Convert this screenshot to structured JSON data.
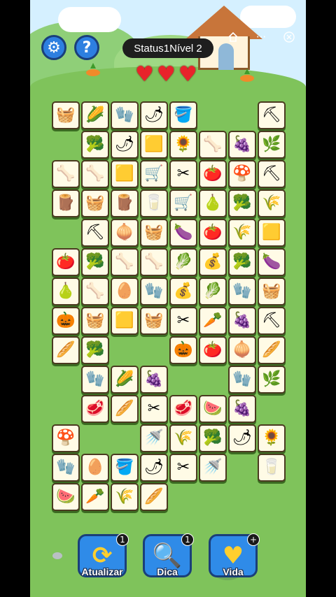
{
  "header": {
    "status_title": "Status1Nível 2",
    "settings_icon": "gear-icon",
    "help_icon": "question-icon",
    "home_icon": "home-icon",
    "more_icon": "more-icon",
    "close_icon": "close-icon",
    "lives": 3
  },
  "board": {
    "tiles": [
      {
        "row": 0,
        "col": 0,
        "icon": "basket",
        "glyph": "🧺"
      },
      {
        "row": 0,
        "col": 1,
        "icon": "corn",
        "glyph": "🌽"
      },
      {
        "row": 0,
        "col": 2,
        "icon": "glove",
        "glyph": "🧤"
      },
      {
        "row": 0,
        "col": 3,
        "icon": "chili-pepper",
        "glyph": "🌶"
      },
      {
        "row": 0,
        "col": 4,
        "icon": "bucket",
        "glyph": "🪣"
      },
      {
        "row": 0,
        "col": 7,
        "icon": "shovel",
        "glyph": "⛏"
      },
      {
        "row": 1,
        "col": 1,
        "icon": "broccoli",
        "glyph": "🥦"
      },
      {
        "row": 1,
        "col": 2,
        "icon": "chili-pepper",
        "glyph": "🌶"
      },
      {
        "row": 1,
        "col": 3,
        "icon": "hay-bale",
        "glyph": "🟨"
      },
      {
        "row": 1,
        "col": 4,
        "icon": "sunflower-seed",
        "glyph": "🌻"
      },
      {
        "row": 1,
        "col": 5,
        "icon": "bone",
        "glyph": "🦴"
      },
      {
        "row": 1,
        "col": 6,
        "icon": "grapes",
        "glyph": "🍇"
      },
      {
        "row": 1,
        "col": 7,
        "icon": "grass",
        "glyph": "🌿"
      },
      {
        "row": 2,
        "col": 0,
        "icon": "bone",
        "glyph": "🦴"
      },
      {
        "row": 2,
        "col": 1,
        "icon": "bone",
        "glyph": "🦴"
      },
      {
        "row": 2,
        "col": 2,
        "icon": "hay-bale",
        "glyph": "🟨"
      },
      {
        "row": 2,
        "col": 3,
        "icon": "wheelbarrow",
        "glyph": "🛒"
      },
      {
        "row": 2,
        "col": 4,
        "icon": "scissors",
        "glyph": "✂"
      },
      {
        "row": 2,
        "col": 5,
        "icon": "tomato",
        "glyph": "🍅"
      },
      {
        "row": 2,
        "col": 6,
        "icon": "mushroom",
        "glyph": "🍄"
      },
      {
        "row": 2,
        "col": 7,
        "icon": "shovel",
        "glyph": "⛏"
      },
      {
        "row": 3,
        "col": 0,
        "icon": "logs",
        "glyph": "🪵"
      },
      {
        "row": 3,
        "col": 1,
        "icon": "basket",
        "glyph": "🧺"
      },
      {
        "row": 3,
        "col": 2,
        "icon": "logs",
        "glyph": "🪵"
      },
      {
        "row": 3,
        "col": 3,
        "icon": "milk-carton",
        "glyph": "🥛"
      },
      {
        "row": 3,
        "col": 4,
        "icon": "wheelbarrow",
        "glyph": "🛒"
      },
      {
        "row": 3,
        "col": 5,
        "icon": "pear",
        "glyph": "🍐"
      },
      {
        "row": 3,
        "col": 6,
        "icon": "broccoli",
        "glyph": "🥦"
      },
      {
        "row": 3,
        "col": 7,
        "icon": "wheat",
        "glyph": "🌾"
      },
      {
        "row": 4,
        "col": 1,
        "icon": "shovel",
        "glyph": "⛏"
      },
      {
        "row": 4,
        "col": 2,
        "icon": "onion",
        "glyph": "🧅"
      },
      {
        "row": 4,
        "col": 3,
        "icon": "basket",
        "glyph": "🧺"
      },
      {
        "row": 4,
        "col": 4,
        "icon": "eggplant",
        "glyph": "🍆"
      },
      {
        "row": 4,
        "col": 5,
        "icon": "tomato",
        "glyph": "🍅"
      },
      {
        "row": 4,
        "col": 6,
        "icon": "wheat",
        "glyph": "🌾"
      },
      {
        "row": 4,
        "col": 7,
        "icon": "hay-bale",
        "glyph": "🟨"
      },
      {
        "row": 5,
        "col": 0,
        "icon": "tomato",
        "glyph": "🍅"
      },
      {
        "row": 5,
        "col": 1,
        "icon": "broccoli",
        "glyph": "🥦"
      },
      {
        "row": 5,
        "col": 2,
        "icon": "bone",
        "glyph": "🦴"
      },
      {
        "row": 5,
        "col": 3,
        "icon": "bone",
        "glyph": "🦴"
      },
      {
        "row": 5,
        "col": 4,
        "icon": "cauliflower",
        "glyph": "🥬"
      },
      {
        "row": 5,
        "col": 5,
        "icon": "seed-bag",
        "glyph": "💰"
      },
      {
        "row": 5,
        "col": 6,
        "icon": "broccoli",
        "glyph": "🥦"
      },
      {
        "row": 5,
        "col": 7,
        "icon": "eggplant",
        "glyph": "🍆"
      },
      {
        "row": 6,
        "col": 0,
        "icon": "pear",
        "glyph": "🍐"
      },
      {
        "row": 6,
        "col": 1,
        "icon": "bone",
        "glyph": "🦴"
      },
      {
        "row": 6,
        "col": 2,
        "icon": "egg",
        "glyph": "🥚"
      },
      {
        "row": 6,
        "col": 3,
        "icon": "glove",
        "glyph": "🧤"
      },
      {
        "row": 6,
        "col": 4,
        "icon": "seed-bag",
        "glyph": "💰"
      },
      {
        "row": 6,
        "col": 5,
        "icon": "cauliflower",
        "glyph": "🥬"
      },
      {
        "row": 6,
        "col": 6,
        "icon": "glove",
        "glyph": "🧤"
      },
      {
        "row": 6,
        "col": 7,
        "icon": "basket",
        "glyph": "🧺"
      },
      {
        "row": 7,
        "col": 0,
        "icon": "pumpkin",
        "glyph": "🎃"
      },
      {
        "row": 7,
        "col": 1,
        "icon": "basket",
        "glyph": "🧺"
      },
      {
        "row": 7,
        "col": 2,
        "icon": "hay-bale",
        "glyph": "🟨"
      },
      {
        "row": 7,
        "col": 3,
        "icon": "basket",
        "glyph": "🧺"
      },
      {
        "row": 7,
        "col": 4,
        "icon": "scissors",
        "glyph": "✂"
      },
      {
        "row": 7,
        "col": 5,
        "icon": "carrot",
        "glyph": "🥕"
      },
      {
        "row": 7,
        "col": 6,
        "icon": "grapes",
        "glyph": "🍇"
      },
      {
        "row": 7,
        "col": 7,
        "icon": "shovel",
        "glyph": "⛏"
      },
      {
        "row": 8,
        "col": 0,
        "icon": "bread",
        "glyph": "🥖"
      },
      {
        "row": 8,
        "col": 1,
        "icon": "broccoli",
        "glyph": "🥦"
      },
      {
        "row": 8,
        "col": 4,
        "icon": "pumpkin",
        "glyph": "🎃"
      },
      {
        "row": 8,
        "col": 5,
        "icon": "tomato",
        "glyph": "🍅"
      },
      {
        "row": 8,
        "col": 6,
        "icon": "onion",
        "glyph": "🧅"
      },
      {
        "row": 8,
        "col": 7,
        "icon": "bread",
        "glyph": "🥖"
      },
      {
        "row": 9,
        "col": 1,
        "icon": "glove",
        "glyph": "🧤"
      },
      {
        "row": 9,
        "col": 2,
        "icon": "corn",
        "glyph": "🌽"
      },
      {
        "row": 9,
        "col": 3,
        "icon": "grapes",
        "glyph": "🍇"
      },
      {
        "row": 9,
        "col": 6,
        "icon": "glove",
        "glyph": "🧤"
      },
      {
        "row": 9,
        "col": 7,
        "icon": "grass",
        "glyph": "🌿"
      },
      {
        "row": 10,
        "col": 1,
        "icon": "meat",
        "glyph": "🥩"
      },
      {
        "row": 10,
        "col": 2,
        "icon": "bread",
        "glyph": "🥖"
      },
      {
        "row": 10,
        "col": 3,
        "icon": "scissors",
        "glyph": "✂"
      },
      {
        "row": 10,
        "col": 4,
        "icon": "meat",
        "glyph": "🥩"
      },
      {
        "row": 10,
        "col": 5,
        "icon": "watermelon",
        "glyph": "🍉"
      },
      {
        "row": 10,
        "col": 6,
        "icon": "grapes",
        "glyph": "🍇"
      },
      {
        "row": 11,
        "col": 0,
        "icon": "mushroom",
        "glyph": "🍄"
      },
      {
        "row": 11,
        "col": 3,
        "icon": "watering-can",
        "glyph": "🚿"
      },
      {
        "row": 11,
        "col": 4,
        "icon": "wheat",
        "glyph": "🌾"
      },
      {
        "row": 11,
        "col": 5,
        "icon": "broccoli",
        "glyph": "🥦"
      },
      {
        "row": 11,
        "col": 6,
        "icon": "chili-pepper",
        "glyph": "🌶"
      },
      {
        "row": 11,
        "col": 7,
        "icon": "sunflower-seed",
        "glyph": "🌻"
      },
      {
        "row": 12,
        "col": 0,
        "icon": "glove",
        "glyph": "🧤"
      },
      {
        "row": 12,
        "col": 1,
        "icon": "egg",
        "glyph": "🥚"
      },
      {
        "row": 12,
        "col": 2,
        "icon": "bucket",
        "glyph": "🪣"
      },
      {
        "row": 12,
        "col": 3,
        "icon": "chili-pepper",
        "glyph": "🌶"
      },
      {
        "row": 12,
        "col": 4,
        "icon": "scissors",
        "glyph": "✂"
      },
      {
        "row": 12,
        "col": 5,
        "icon": "watering-can",
        "glyph": "🚿"
      },
      {
        "row": 12,
        "col": 7,
        "icon": "milk-carton",
        "glyph": "🥛"
      },
      {
        "row": 13,
        "col": 0,
        "icon": "watermelon",
        "glyph": "🍉"
      },
      {
        "row": 13,
        "col": 1,
        "icon": "carrot",
        "glyph": "🥕"
      },
      {
        "row": 13,
        "col": 2,
        "icon": "wheat",
        "glyph": "🌾"
      },
      {
        "row": 13,
        "col": 3,
        "icon": "bread",
        "glyph": "🥖"
      }
    ]
  },
  "actions": {
    "refresh": {
      "label": "Atualizar",
      "badge": "1",
      "icon": "refresh-icon"
    },
    "hint": {
      "label": "Dica",
      "badge": "1",
      "icon": "magnifier-icon"
    },
    "life": {
      "label": "Vida",
      "badge": "+",
      "icon": "heart-plus-icon"
    }
  }
}
